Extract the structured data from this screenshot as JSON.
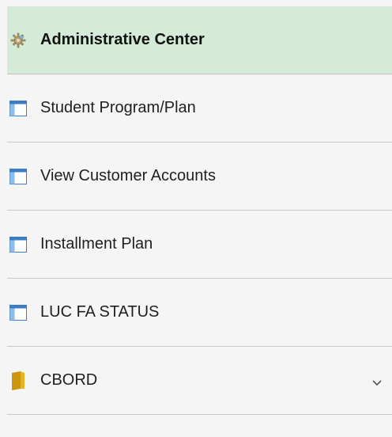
{
  "menu": {
    "header": {
      "label": "Administrative Center",
      "icon": "admin-gear-icon"
    },
    "items": [
      {
        "label": "Student Program/Plan",
        "icon": "window-icon"
      },
      {
        "label": "View Customer Accounts",
        "icon": "window-icon"
      },
      {
        "label": "Installment Plan",
        "icon": "window-icon"
      },
      {
        "label": "LUC FA STATUS",
        "icon": "window-icon"
      },
      {
        "label": "CBORD",
        "icon": "folder-icon",
        "expandable": true
      }
    ]
  },
  "colors": {
    "header_bg": "#d4ebd8",
    "page_bg": "#f5f5f5",
    "divider": "#c8c8c8",
    "window_icon_blue": "#4a90d9",
    "folder_icon_gold": "#c9960c"
  }
}
